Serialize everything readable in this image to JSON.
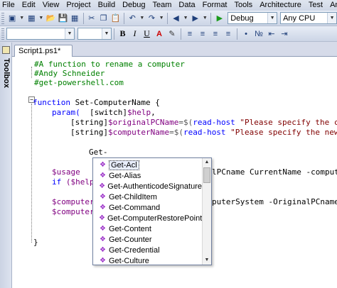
{
  "menu": [
    "File",
    "Edit",
    "View",
    "Project",
    "Build",
    "Debug",
    "Team",
    "Data",
    "Format",
    "Tools",
    "Architecture",
    "Test",
    "Analyze"
  ],
  "toolbar": {
    "configuration": "Debug",
    "platform": "Any CPU",
    "font_name": "",
    "font_size": "",
    "bold": "B",
    "italic": "I",
    "underline": "U"
  },
  "toolbox": {
    "label": "Toolbox"
  },
  "tab": {
    "title": "Script1.ps1*"
  },
  "code": {
    "l1": "#A function to rename a computer",
    "l2": "#Andy Schneider",
    "l3": "#get-powershell.com",
    "l5_kw": "function",
    "l5_name": "Set-ComputerName",
    "l5_rest": " {",
    "l6_kw": "param(",
    "l6_type": "[switch]",
    "l6_var": "$help",
    "l6_rest": ",",
    "l7_type": "[string]",
    "l7_var": "$originalPCName",
    "l7_op": "=$(",
    "l7_cmd": "read-host",
    "l7_str": " \"Please specify the cu",
    "l8_type": "[string]",
    "l8_var": "$computerName",
    "l8_op": "=$(",
    "l8_cmd": "read-host",
    "l8_str": " \"Please specify the new",
    "l10": "Get-",
    "l12_var": "$usage",
    "l12_tail": "lPCname CurrentName -comput",
    "l13_kw": "if",
    "l13_var": " ($help",
    "l15_var": "$computer",
    "l15_tail": "puterSystem -OriginalPCname",
    "l16_var": "$computer",
    "l17": "}"
  },
  "popup": {
    "items": [
      "Get-Acl",
      "Get-Alias",
      "Get-AuthenticodeSignature",
      "Get-ChildItem",
      "Get-Command",
      "Get-ComputerRestorePoint",
      "Get-Content",
      "Get-Counter",
      "Get-Credential",
      "Get-Culture"
    ],
    "selected": "Get-Acl"
  }
}
